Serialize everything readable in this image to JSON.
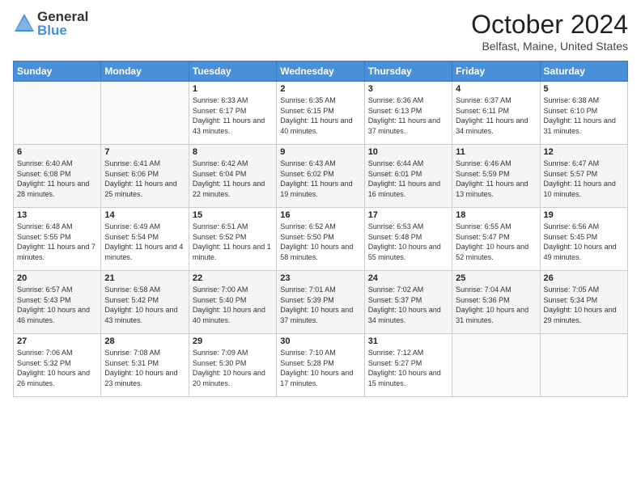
{
  "header": {
    "logo_general": "General",
    "logo_blue": "Blue",
    "month_title": "October 2024",
    "location": "Belfast, Maine, United States"
  },
  "days_of_week": [
    "Sunday",
    "Monday",
    "Tuesday",
    "Wednesday",
    "Thursday",
    "Friday",
    "Saturday"
  ],
  "weeks": [
    [
      {
        "day": "",
        "info": ""
      },
      {
        "day": "",
        "info": ""
      },
      {
        "day": "1",
        "info": "Sunrise: 6:33 AM\nSunset: 6:17 PM\nDaylight: 11 hours\nand 43 minutes."
      },
      {
        "day": "2",
        "info": "Sunrise: 6:35 AM\nSunset: 6:15 PM\nDaylight: 11 hours\nand 40 minutes."
      },
      {
        "day": "3",
        "info": "Sunrise: 6:36 AM\nSunset: 6:13 PM\nDaylight: 11 hours\nand 37 minutes."
      },
      {
        "day": "4",
        "info": "Sunrise: 6:37 AM\nSunset: 6:11 PM\nDaylight: 11 hours\nand 34 minutes."
      },
      {
        "day": "5",
        "info": "Sunrise: 6:38 AM\nSunset: 6:10 PM\nDaylight: 11 hours\nand 31 minutes."
      }
    ],
    [
      {
        "day": "6",
        "info": "Sunrise: 6:40 AM\nSunset: 6:08 PM\nDaylight: 11 hours\nand 28 minutes."
      },
      {
        "day": "7",
        "info": "Sunrise: 6:41 AM\nSunset: 6:06 PM\nDaylight: 11 hours\nand 25 minutes."
      },
      {
        "day": "8",
        "info": "Sunrise: 6:42 AM\nSunset: 6:04 PM\nDaylight: 11 hours\nand 22 minutes."
      },
      {
        "day": "9",
        "info": "Sunrise: 6:43 AM\nSunset: 6:02 PM\nDaylight: 11 hours\nand 19 minutes."
      },
      {
        "day": "10",
        "info": "Sunrise: 6:44 AM\nSunset: 6:01 PM\nDaylight: 11 hours\nand 16 minutes."
      },
      {
        "day": "11",
        "info": "Sunrise: 6:46 AM\nSunset: 5:59 PM\nDaylight: 11 hours\nand 13 minutes."
      },
      {
        "day": "12",
        "info": "Sunrise: 6:47 AM\nSunset: 5:57 PM\nDaylight: 11 hours\nand 10 minutes."
      }
    ],
    [
      {
        "day": "13",
        "info": "Sunrise: 6:48 AM\nSunset: 5:55 PM\nDaylight: 11 hours\nand 7 minutes."
      },
      {
        "day": "14",
        "info": "Sunrise: 6:49 AM\nSunset: 5:54 PM\nDaylight: 11 hours\nand 4 minutes."
      },
      {
        "day": "15",
        "info": "Sunrise: 6:51 AM\nSunset: 5:52 PM\nDaylight: 11 hours\nand 1 minute."
      },
      {
        "day": "16",
        "info": "Sunrise: 6:52 AM\nSunset: 5:50 PM\nDaylight: 10 hours\nand 58 minutes."
      },
      {
        "day": "17",
        "info": "Sunrise: 6:53 AM\nSunset: 5:48 PM\nDaylight: 10 hours\nand 55 minutes."
      },
      {
        "day": "18",
        "info": "Sunrise: 6:55 AM\nSunset: 5:47 PM\nDaylight: 10 hours\nand 52 minutes."
      },
      {
        "day": "19",
        "info": "Sunrise: 6:56 AM\nSunset: 5:45 PM\nDaylight: 10 hours\nand 49 minutes."
      }
    ],
    [
      {
        "day": "20",
        "info": "Sunrise: 6:57 AM\nSunset: 5:43 PM\nDaylight: 10 hours\nand 46 minutes."
      },
      {
        "day": "21",
        "info": "Sunrise: 6:58 AM\nSunset: 5:42 PM\nDaylight: 10 hours\nand 43 minutes."
      },
      {
        "day": "22",
        "info": "Sunrise: 7:00 AM\nSunset: 5:40 PM\nDaylight: 10 hours\nand 40 minutes."
      },
      {
        "day": "23",
        "info": "Sunrise: 7:01 AM\nSunset: 5:39 PM\nDaylight: 10 hours\nand 37 minutes."
      },
      {
        "day": "24",
        "info": "Sunrise: 7:02 AM\nSunset: 5:37 PM\nDaylight: 10 hours\nand 34 minutes."
      },
      {
        "day": "25",
        "info": "Sunrise: 7:04 AM\nSunset: 5:36 PM\nDaylight: 10 hours\nand 31 minutes."
      },
      {
        "day": "26",
        "info": "Sunrise: 7:05 AM\nSunset: 5:34 PM\nDaylight: 10 hours\nand 29 minutes."
      }
    ],
    [
      {
        "day": "27",
        "info": "Sunrise: 7:06 AM\nSunset: 5:32 PM\nDaylight: 10 hours\nand 26 minutes."
      },
      {
        "day": "28",
        "info": "Sunrise: 7:08 AM\nSunset: 5:31 PM\nDaylight: 10 hours\nand 23 minutes."
      },
      {
        "day": "29",
        "info": "Sunrise: 7:09 AM\nSunset: 5:30 PM\nDaylight: 10 hours\nand 20 minutes."
      },
      {
        "day": "30",
        "info": "Sunrise: 7:10 AM\nSunset: 5:28 PM\nDaylight: 10 hours\nand 17 minutes."
      },
      {
        "day": "31",
        "info": "Sunrise: 7:12 AM\nSunset: 5:27 PM\nDaylight: 10 hours\nand 15 minutes."
      },
      {
        "day": "",
        "info": ""
      },
      {
        "day": "",
        "info": ""
      }
    ]
  ]
}
